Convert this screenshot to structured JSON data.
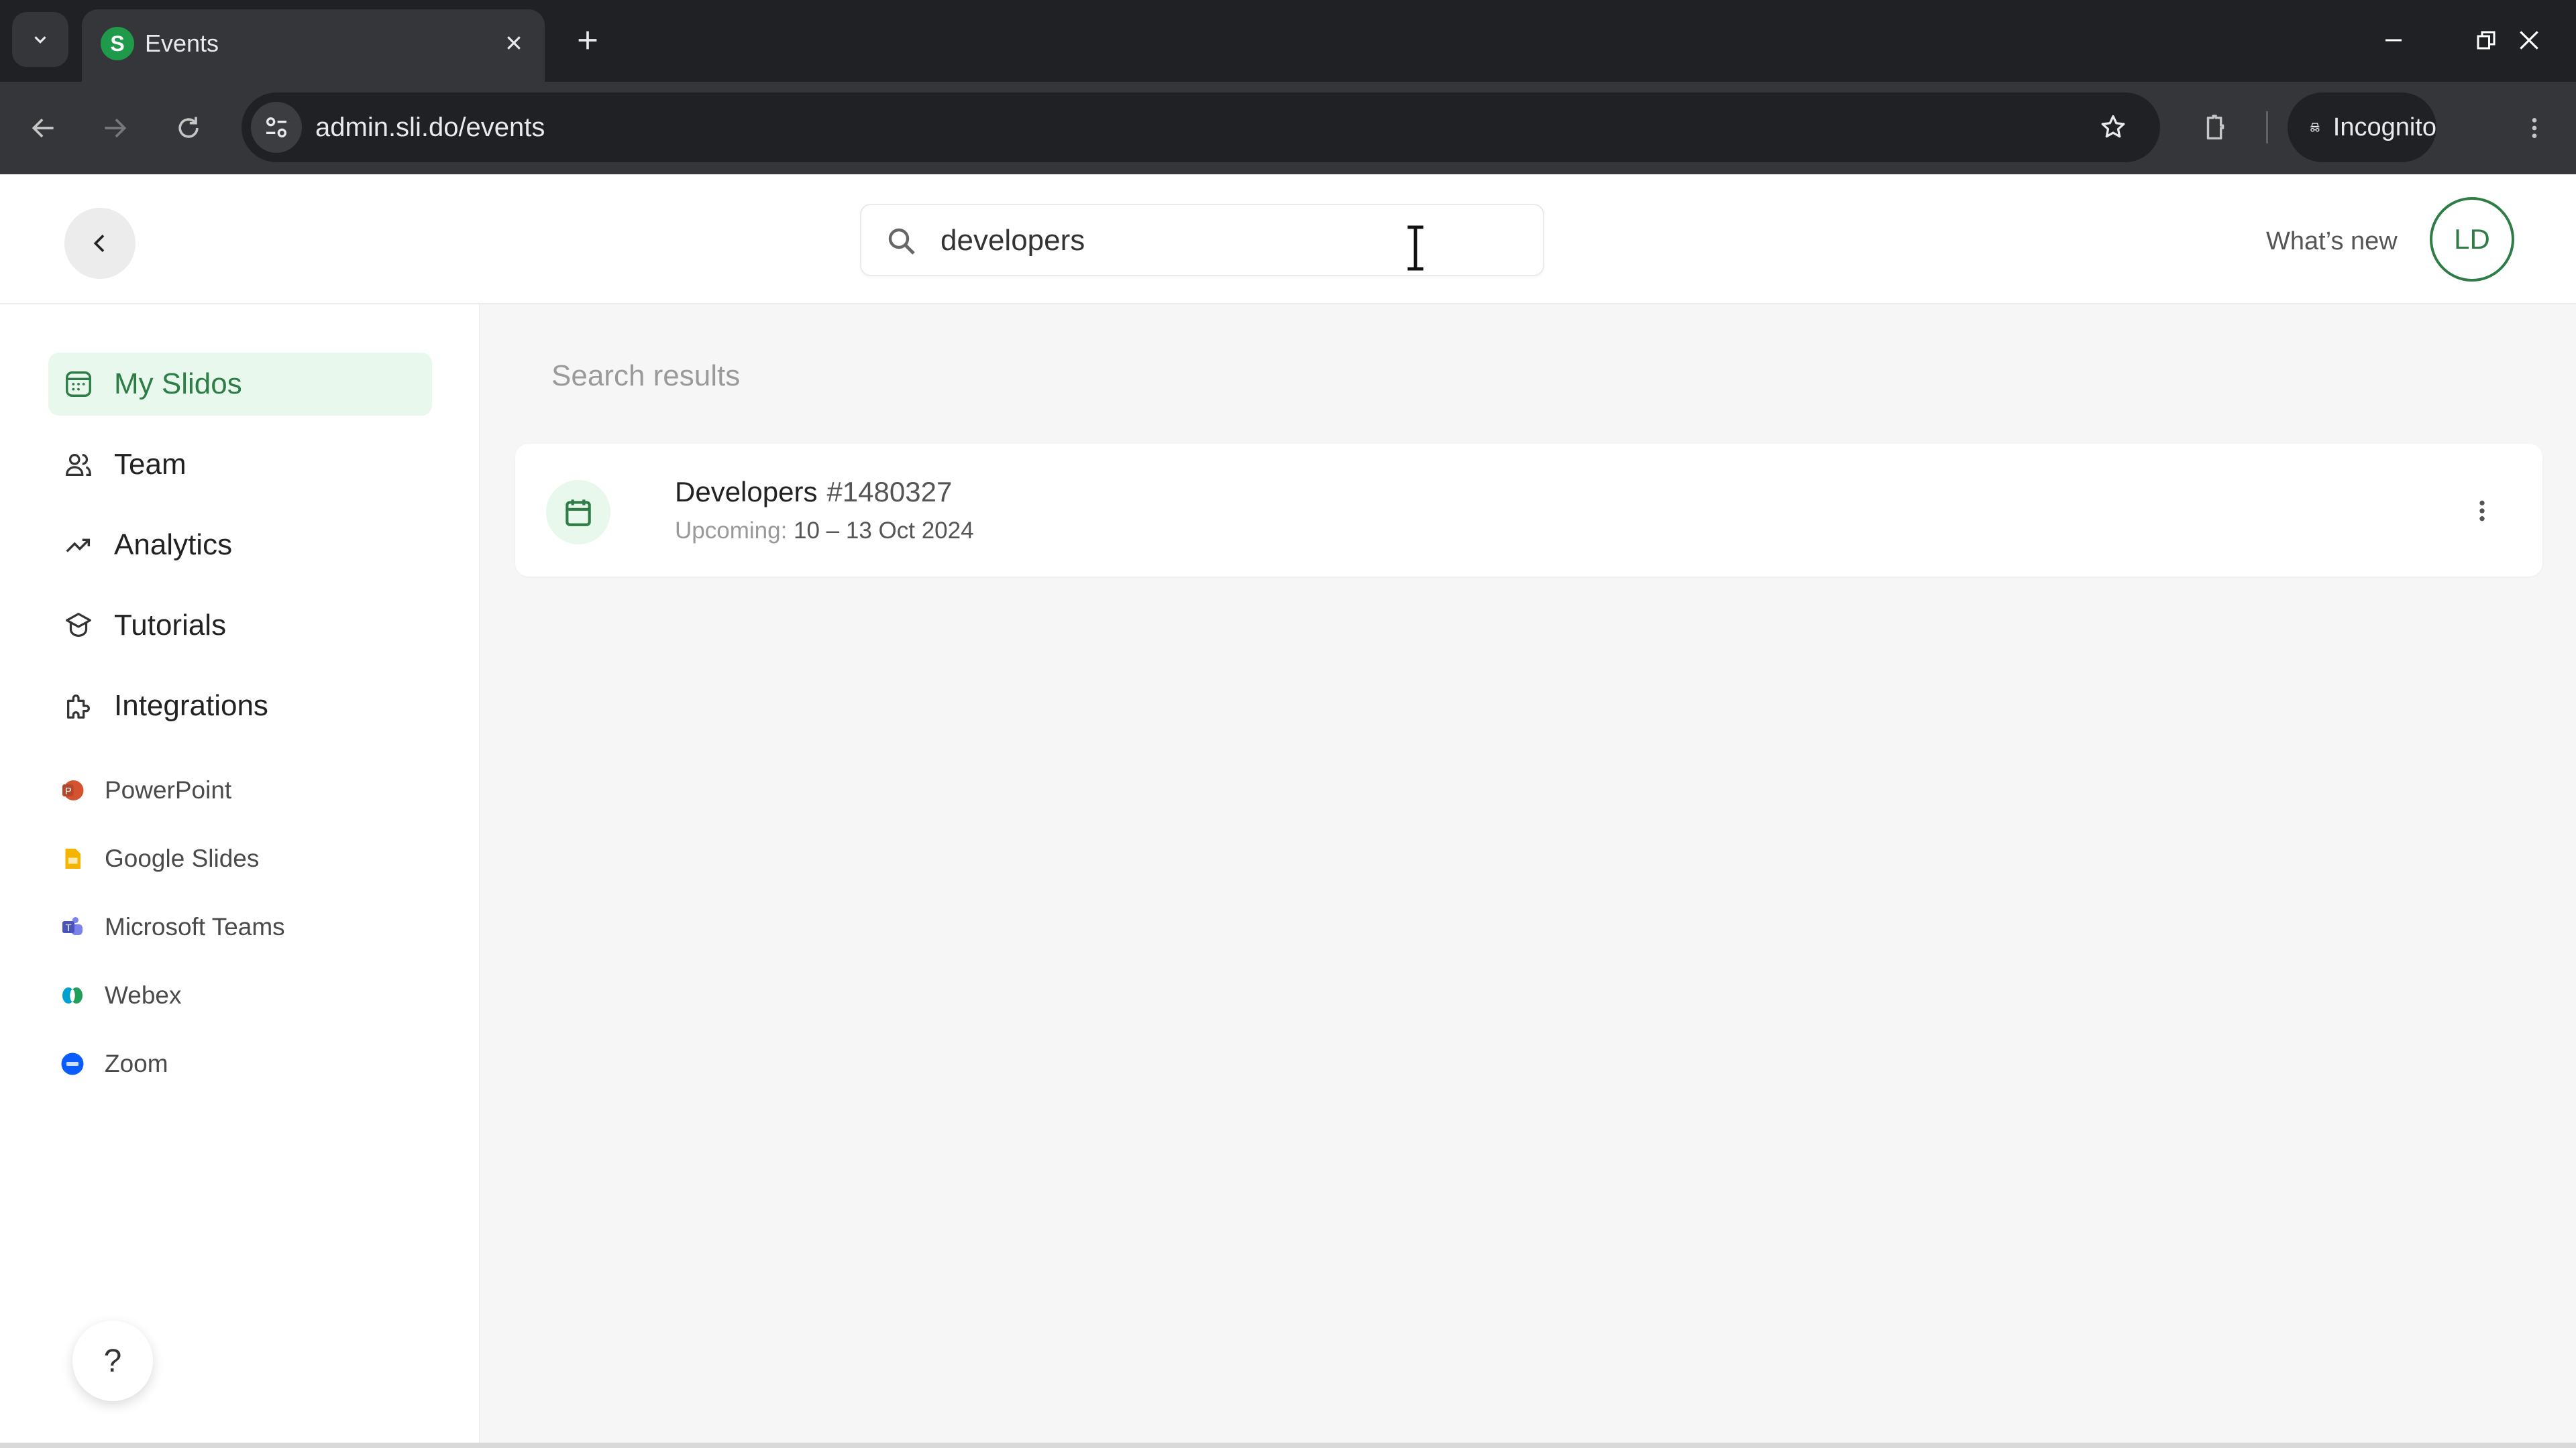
{
  "browser": {
    "tab_title": "Events",
    "favicon_letter": "S",
    "url": "admin.sli.do/events",
    "incognito_label": "Incognito"
  },
  "header": {
    "search_value": "developers",
    "whats_new_label": "What’s new",
    "avatar_initials": "LD"
  },
  "sidebar": {
    "nav": [
      {
        "label": "My Slidos",
        "icon": "calendar-grid-icon",
        "active": true
      },
      {
        "label": "Team",
        "icon": "users-icon",
        "active": false
      },
      {
        "label": "Analytics",
        "icon": "trend-up-icon",
        "active": false
      },
      {
        "label": "Tutorials",
        "icon": "graduation-cap-icon",
        "active": false
      },
      {
        "label": "Integrations",
        "icon": "puzzle-icon",
        "active": false
      }
    ],
    "integrations": [
      {
        "label": "PowerPoint",
        "icon": "powerpoint-icon"
      },
      {
        "label": "Google Slides",
        "icon": "google-slides-icon"
      },
      {
        "label": "Microsoft Teams",
        "icon": "microsoft-teams-icon"
      },
      {
        "label": "Webex",
        "icon": "webex-icon"
      },
      {
        "label": "Zoom",
        "icon": "zoom-icon"
      }
    ],
    "help_label": "?"
  },
  "main": {
    "results_title": "Search results",
    "results": [
      {
        "name": "Developers",
        "code": "#1480327",
        "status": "Upcoming:",
        "dates": "10 – 13 Oct 2024"
      }
    ]
  },
  "colors": {
    "brand_green": "#2e7d46",
    "active_bg": "#e8f8ec"
  }
}
